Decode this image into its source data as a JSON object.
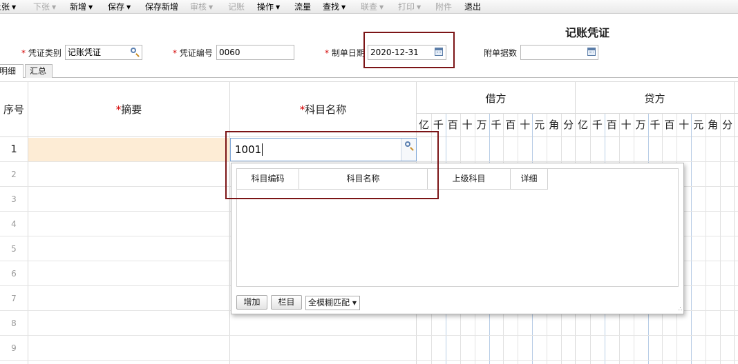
{
  "toolbar": {
    "items": [
      {
        "label": "上张",
        "caret": true,
        "disabled": false
      },
      {
        "label": "下张",
        "caret": true,
        "disabled": true
      },
      {
        "label": "新增",
        "caret": true,
        "disabled": false
      },
      {
        "label": "保存",
        "caret": true,
        "disabled": false
      },
      {
        "label": "保存新增",
        "caret": false,
        "disabled": false
      },
      {
        "label": "审核",
        "caret": true,
        "disabled": true
      },
      {
        "label": "记账",
        "caret": false,
        "disabled": true
      },
      {
        "label": "操作",
        "caret": true,
        "disabled": false
      },
      {
        "label": "流量",
        "caret": false,
        "disabled": false
      },
      {
        "label": "查找",
        "caret": true,
        "disabled": false
      },
      {
        "label": "联查",
        "caret": true,
        "disabled": true
      },
      {
        "label": "打印",
        "caret": true,
        "disabled": true
      },
      {
        "label": "附件",
        "caret": false,
        "disabled": true
      },
      {
        "label": "退出",
        "caret": false,
        "disabled": false
      }
    ]
  },
  "voucher": {
    "title": "记账凭证",
    "type_label": "凭证类别",
    "type_value": "记账凭证",
    "number_label": "凭证编号",
    "number_value": "0060",
    "date_label": "制单日期",
    "date_value": "2020-12-31",
    "attach_label": "附单据数",
    "attach_value": ""
  },
  "tabs": [
    "明细",
    "汇总"
  ],
  "grid": {
    "headers": {
      "seq": "序号",
      "summary": "摘要",
      "account": "科目名称",
      "debit": "借方",
      "credit": "贷方"
    },
    "digits": [
      "亿",
      "千",
      "百",
      "十",
      "万",
      "千",
      "百",
      "十",
      "元",
      "角",
      "分"
    ],
    "rows": [
      "1",
      "2",
      "3",
      "4",
      "5",
      "6",
      "7",
      "8",
      "9"
    ],
    "account_input": "1001"
  },
  "popup": {
    "columns": [
      "科目编码",
      "科目名称",
      "上级科目",
      "详细"
    ],
    "add_button": "增加",
    "columns_button": "栏目",
    "match_mode": "全模糊匹配"
  },
  "colors": {
    "highlight": "#7b1416",
    "required": "#d40000",
    "active_row": "#fdecd5"
  }
}
